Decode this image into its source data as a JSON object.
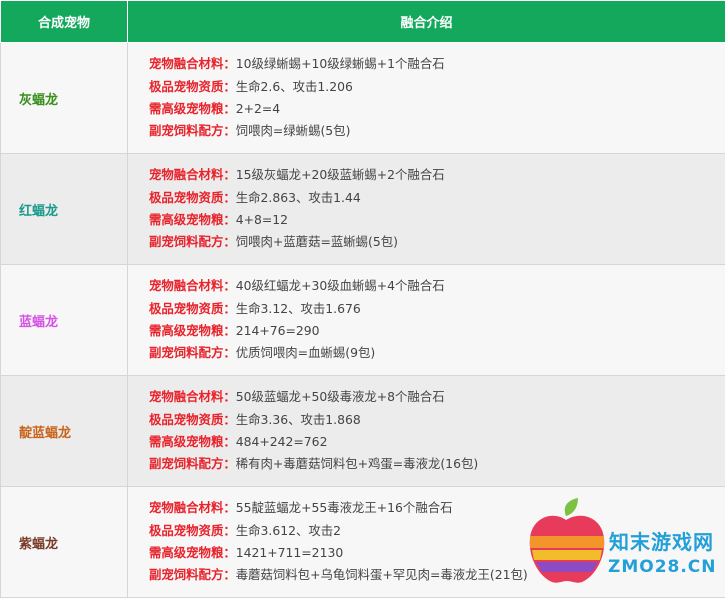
{
  "header": {
    "col1": "合成宠物",
    "col2": "融合介绍"
  },
  "pets": [
    {
      "name": "灰蝠龙",
      "name_color": "#3a8f1e",
      "lines": [
        {
          "label": "宠物融合材料：",
          "value": "10级绿蜥蜴+10级绿蜥蜴+1个融合石"
        },
        {
          "label": "极品宠物资质：",
          "value": "生命2.6、攻击1.206"
        },
        {
          "label": "需高级宠物粮：",
          "value": "2+2=4"
        },
        {
          "label": "副宠饲料配方：",
          "value": "饲喂肉=绿蜥蜴(5包)"
        }
      ]
    },
    {
      "name": "红蝠龙",
      "name_color": "#1a9a8a",
      "lines": [
        {
          "label": "宠物融合材料：",
          "value": "15级灰蝠龙+20级蓝蜥蜴+2个融合石"
        },
        {
          "label": "极品宠物资质：",
          "value": "生命2.863、攻击1.44"
        },
        {
          "label": "需高级宠物粮：",
          "value": "4+8=12"
        },
        {
          "label": "副宠饲料配方：",
          "value": "饲喂肉+蓝蘑菇=蓝蜥蜴(5包)"
        }
      ]
    },
    {
      "name": "蓝蝠龙",
      "name_color": "#d653e6",
      "lines": [
        {
          "label": "宠物融合材料：",
          "value": "40级红蝠龙+30级血蜥蜴+4个融合石"
        },
        {
          "label": "极品宠物资质：",
          "value": "生命3.12、攻击1.676"
        },
        {
          "label": "需高级宠物粮：",
          "value": "214+76=290"
        },
        {
          "label": "副宠饲料配方：",
          "value": "优质饲喂肉=血蜥蜴(9包)"
        }
      ]
    },
    {
      "name": "靛蓝蝠龙",
      "name_color": "#c8641e",
      "lines": [
        {
          "label": "宠物融合材料：",
          "value": "50级蓝蝠龙+50级毒液龙+8个融合石"
        },
        {
          "label": "极品宠物资质：",
          "value": "生命3.36、攻击1.868"
        },
        {
          "label": "需高级宠物粮：",
          "value": "484+242=762"
        },
        {
          "label": "副宠饲料配方：",
          "value": "稀有肉+毒蘑菇饲料包+鸡蛋=毒液龙(16包)"
        }
      ]
    },
    {
      "name": "紫蝠龙",
      "name_color": "#7a3c2a",
      "lines": [
        {
          "label": "宠物融合材料：",
          "value": "55靛蓝蝠龙+55毒液龙王+16个融合石"
        },
        {
          "label": "极品宠物资质：",
          "value": "生命3.612、攻击2"
        },
        {
          "label": "需高级宠物粮：",
          "value": "1421+711=2130"
        },
        {
          "label": "副宠饲料配方：",
          "value": "毒蘑菇饲料包+乌龟饲料蛋+罕见肉=毒液龙王(21包)"
        }
      ]
    }
  ],
  "watermark": {
    "site_cn": "知末游戏网",
    "site_en": "ZMO28.CN"
  },
  "colors": {
    "header_bg": "#14a85c",
    "label": "#e8232c",
    "brand": "#23a0d8"
  }
}
